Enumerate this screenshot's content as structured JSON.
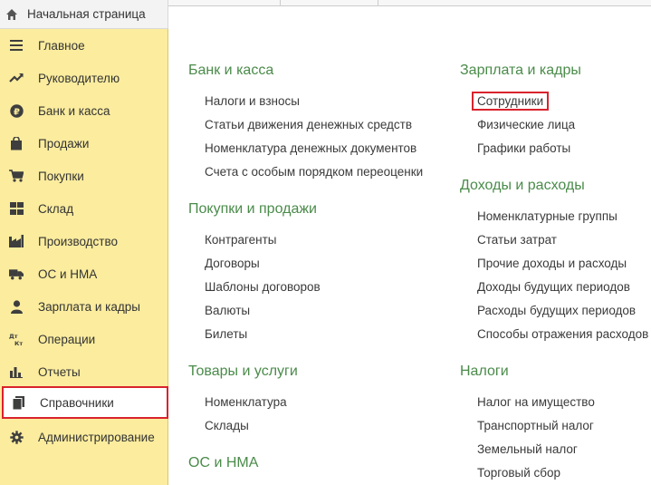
{
  "topbar": {
    "home_label": "Начальная страница"
  },
  "sidebar": {
    "items": [
      {
        "label": "Главное",
        "icon": "menu-lines-icon"
      },
      {
        "label": "Руководителю",
        "icon": "trend-chart-icon"
      },
      {
        "label": "Банк и касса",
        "icon": "ruble-coin-icon"
      },
      {
        "label": "Продажи",
        "icon": "shopping-bag-icon"
      },
      {
        "label": "Покупки",
        "icon": "cart-icon"
      },
      {
        "label": "Склад",
        "icon": "warehouse-grid-icon"
      },
      {
        "label": "Производство",
        "icon": "factory-icon"
      },
      {
        "label": "ОС и НМА",
        "icon": "truck-icon"
      },
      {
        "label": "Зарплата и кадры",
        "icon": "person-icon"
      },
      {
        "label": "Операции",
        "icon": "dt-kt-icon"
      },
      {
        "label": "Отчеты",
        "icon": "bar-chart-icon"
      },
      {
        "label": "Справочники",
        "icon": "book-icon"
      },
      {
        "label": "Администрирование",
        "icon": "gear-icon"
      }
    ],
    "active": "Справочники"
  },
  "main": {
    "left": {
      "bank": {
        "title": "Банк и касса",
        "links": [
          "Налоги и взносы",
          "Статьи движения денежных средств",
          "Номенклатура денежных документов",
          "Счета с особым порядком переоценки"
        ]
      },
      "purchases": {
        "title": "Покупки и продажи",
        "links": [
          "Контрагенты",
          "Договоры",
          "Шаблоны договоров",
          "Валюты",
          "Билеты"
        ]
      },
      "goods": {
        "title": "Товары и услуги",
        "links": [
          "Номенклатура",
          "Склады"
        ]
      },
      "os": {
        "title": "ОС и НМА"
      }
    },
    "right": {
      "salary": {
        "title": "Зарплата и кадры",
        "links": [
          "Сотрудники",
          "Физические лица",
          "Графики работы"
        ]
      },
      "income": {
        "title": "Доходы и расходы",
        "links": [
          "Номенклатурные группы",
          "Статьи затрат",
          "Прочие доходы и расходы",
          "Доходы будущих периодов",
          "Расходы будущих периодов",
          "Способы отражения расходов"
        ]
      },
      "taxes": {
        "title": "Налоги",
        "links": [
          "Налог на имущество",
          "Транспортный налог",
          "Земельный налог",
          "Торговый сбор"
        ]
      }
    }
  }
}
